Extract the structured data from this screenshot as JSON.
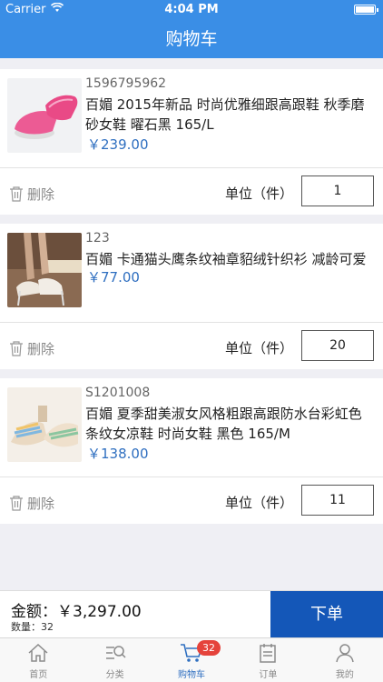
{
  "status_bar": {
    "carrier": "Carrier",
    "time": "4:04 PM"
  },
  "nav": {
    "title": "购物车"
  },
  "items": [
    {
      "code": "1596795962",
      "title": "百媚 2015年新品 时尚优雅细跟高跟鞋 秋季磨砂女鞋 曜石黑 165/L",
      "price": "￥239.00",
      "delete_label": "删除",
      "unit_label": "单位（件）",
      "quantity": "1"
    },
    {
      "code": "123",
      "title": "百媚 卡通猫头鹰条纹袖章貂绒针织衫 减龄可爱",
      "price": "￥77.00",
      "delete_label": "删除",
      "unit_label": "单位（件）",
      "quantity": "20"
    },
    {
      "code": "S1201008",
      "title": "百媚 夏季甜美淑女风格粗跟高跟防水台彩虹色条纹女凉鞋 时尚女鞋 黑色 165/M",
      "price": "￥138.00",
      "delete_label": "删除",
      "unit_label": "单位（件）",
      "quantity": "11"
    }
  ],
  "footer": {
    "amount_label": "金额：￥3,297.00",
    "count_label": "数量：32",
    "order_button": "下单"
  },
  "tabs": [
    {
      "label": "首页",
      "icon": "home-icon"
    },
    {
      "label": "分类",
      "icon": "category-search-icon"
    },
    {
      "label": "购物车",
      "icon": "cart-icon",
      "badge": "32",
      "active": true
    },
    {
      "label": "订单",
      "icon": "order-list-icon"
    },
    {
      "label": "我的",
      "icon": "user-icon"
    }
  ],
  "colors": {
    "nav": "#3a8ee6",
    "price": "#2f6fc0",
    "order_button": "#1457b8",
    "badge": "#e5433b"
  }
}
